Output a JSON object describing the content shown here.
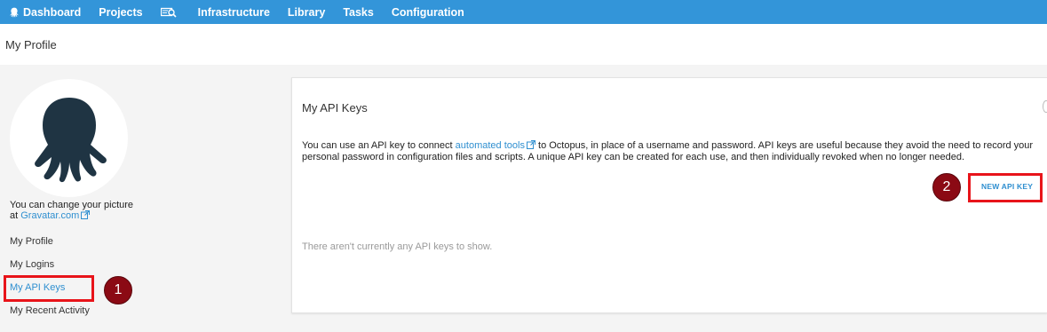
{
  "nav": {
    "items": [
      {
        "label": "Dashboard",
        "icon": "octopus-icon"
      },
      {
        "label": "Projects"
      },
      {
        "label": "",
        "icon": "search-machine-icon"
      },
      {
        "label": "Infrastructure"
      },
      {
        "label": "Library"
      },
      {
        "label": "Tasks"
      },
      {
        "label": "Configuration"
      }
    ]
  },
  "page": {
    "title": "My Profile"
  },
  "sidebar": {
    "change_picture_text": "You can change your picture",
    "change_picture_at": "at",
    "gravatar_link": "Gravatar.com",
    "links": [
      {
        "label": "My Profile"
      },
      {
        "label": "My Logins"
      },
      {
        "label": "My API Keys",
        "active": true
      },
      {
        "label": "My Recent Activity"
      }
    ]
  },
  "panel": {
    "title": "My API Keys",
    "desc_before": "You can use an API key to connect",
    "desc_link": "automated tools",
    "desc_after": "to Octopus, in place of a username and password. API keys are useful because they avoid the need to record your personal password in configuration files and scripts. A unique API key can be created for each use, and then individually revoked when no longer needed.",
    "new_key_button": "NEW API KEY",
    "empty_message": "There aren't currently any API keys to show."
  },
  "annotations": {
    "badge_1": "1",
    "badge_2": "2"
  },
  "colors": {
    "nav_bg": "#3395d9",
    "link": "#2f8fd0",
    "highlight": "#e8141a",
    "badge": "#8b0a14",
    "avatar": "#1f3443"
  }
}
